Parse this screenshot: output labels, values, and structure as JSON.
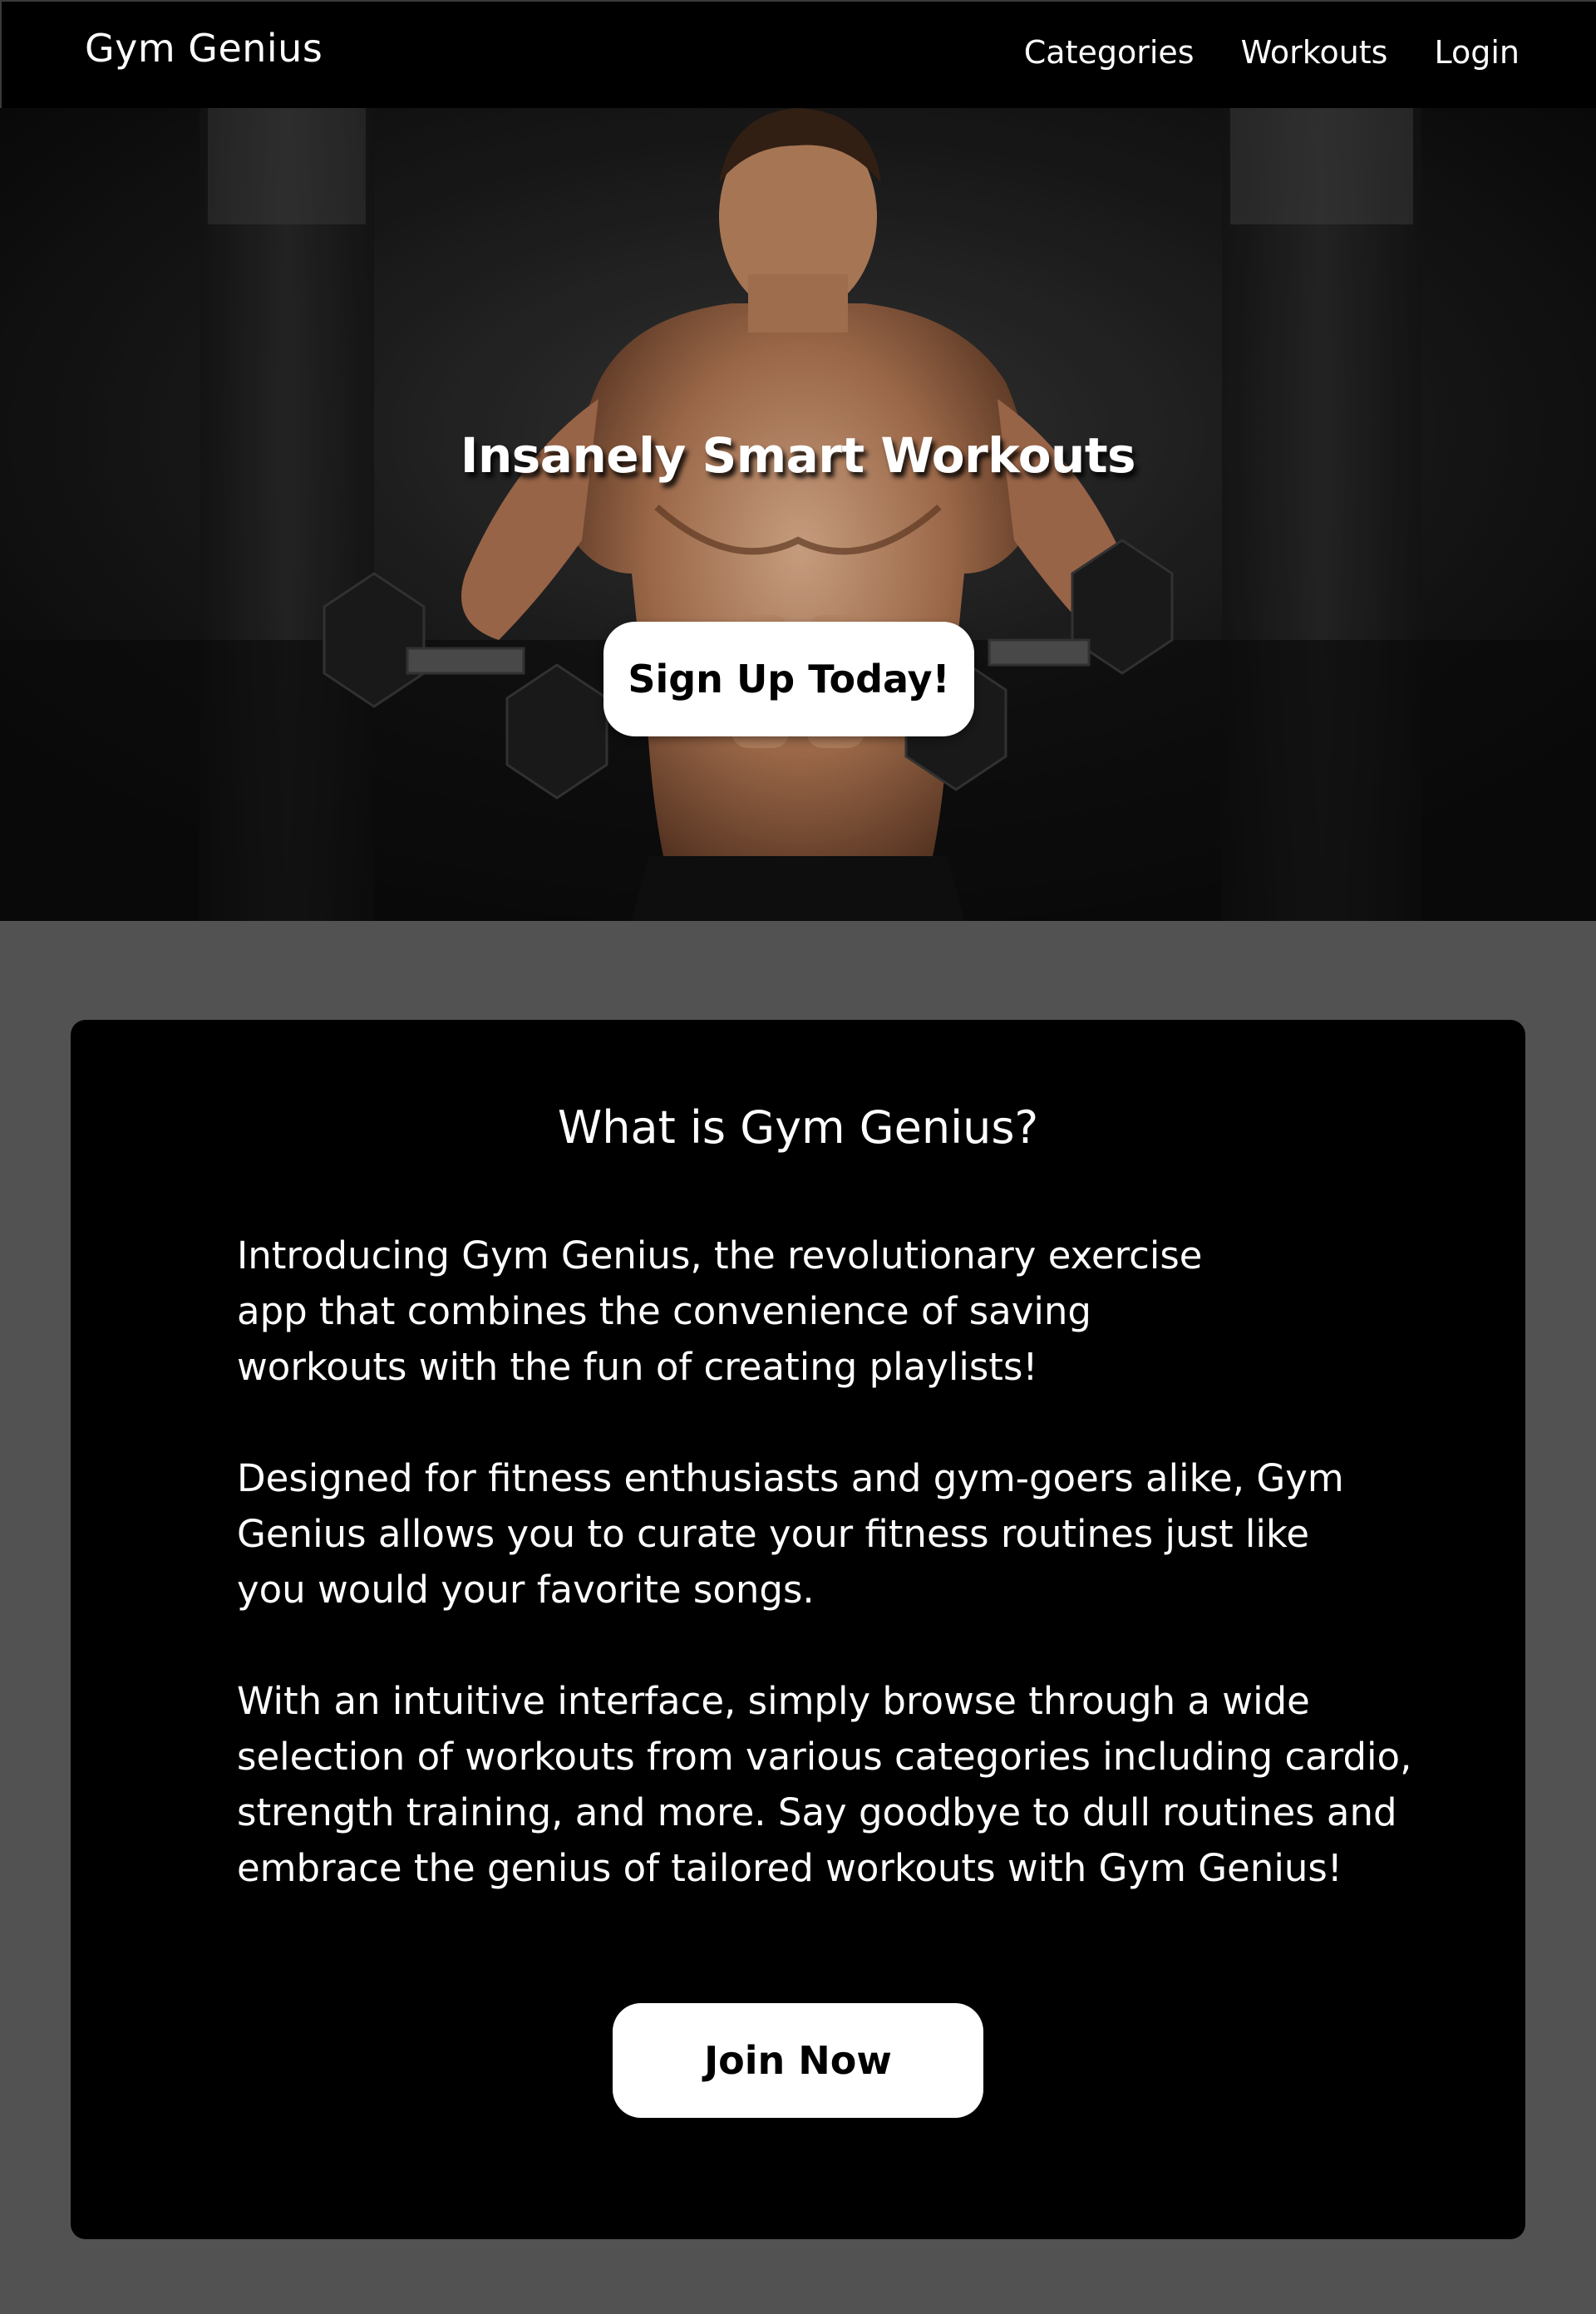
{
  "navbar": {
    "brand": "Gym Genius",
    "links": [
      {
        "label": "Categories"
      },
      {
        "label": "Workouts"
      },
      {
        "label": "Login"
      }
    ]
  },
  "hero": {
    "title": "Insanely Smart Workouts",
    "cta_label": "Sign Up Today!",
    "image_subject": "muscular man holding dumbbells in dark gym"
  },
  "about": {
    "title": "What is Gym Genius?",
    "paragraphs": [
      "Introducing Gym Genius, the revolutionary exercise app that combines the convenience of saving workouts with the fun of creating playlists!",
      "Designed for fitness enthusiasts and gym-goers alike, Gym Genius allows you to curate your fitness routines just like you would your favorite songs.",
      "With an intuitive interface, simply browse through a wide selection of workouts from various categories including cardio, strength training, and more. Say goodbye to dull routines and embrace the genius of tailored workouts with Gym Genius!"
    ],
    "cta_label": "Join Now"
  },
  "colors": {
    "page_background": "#525252",
    "navbar_background": "#000000",
    "card_background": "#000000",
    "button_background": "#ffffff",
    "button_text": "#000000",
    "text": "#ffffff"
  }
}
